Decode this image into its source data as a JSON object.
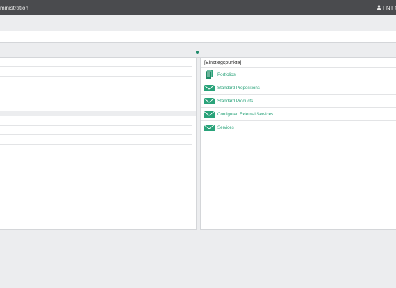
{
  "topbar": {
    "title": "ministration",
    "user_label": "FNT S",
    "user_icon": "user-icon"
  },
  "entry_points": {
    "header": "[Einstiegspunkte]",
    "items": [
      {
        "label": "Portfolios",
        "icon": "portfolio-icon"
      },
      {
        "label": "Standard Propositions",
        "icon": "envelope-icon"
      },
      {
        "label": "Standard Products",
        "icon": "envelope-icon"
      },
      {
        "label": "Configured External Services",
        "icon": "envelope-icon"
      },
      {
        "label": "Services",
        "icon": "envelope-icon"
      }
    ]
  },
  "colors": {
    "topbar": "#4a4b4e",
    "accent": "#2aa37a",
    "background": "#ecedef"
  }
}
